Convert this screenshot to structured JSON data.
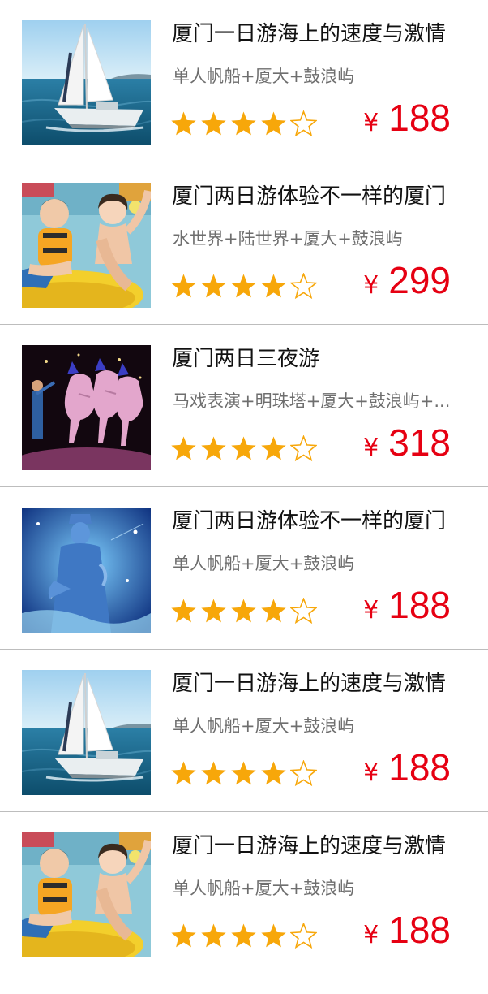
{
  "items": [
    {
      "title": "厦门一日游海上的速度与激情",
      "subtitle": "单人帆船+厦大+鼓浪屿",
      "rating": 4,
      "max_rating": 5,
      "currency": "¥",
      "price": "188",
      "image": "sailboat"
    },
    {
      "title": "厦门两日游体验不一样的厦门",
      "subtitle": "水世界+陆世界+厦大+鼓浪屿",
      "rating": 4,
      "max_rating": 5,
      "currency": "¥",
      "price": "299",
      "image": "water-park"
    },
    {
      "title": "厦门两日三夜游",
      "subtitle": "马戏表演+明珠塔+厦大+鼓浪屿+...",
      "rating": 4,
      "max_rating": 5,
      "currency": "¥",
      "price": "318",
      "image": "circus-horses"
    },
    {
      "title": "厦门两日游体验不一样的厦门",
      "subtitle": "单人帆船+厦大+鼓浪屿",
      "rating": 4,
      "max_rating": 5,
      "currency": "¥",
      "price": "188",
      "image": "statue"
    },
    {
      "title": "厦门一日游海上的速度与激情",
      "subtitle": "单人帆船+厦大+鼓浪屿",
      "rating": 4,
      "max_rating": 5,
      "currency": "¥",
      "price": "188",
      "image": "sailboat"
    },
    {
      "title": "厦门一日游海上的速度与激情",
      "subtitle": "单人帆船+厦大+鼓浪屿",
      "rating": 4,
      "max_rating": 5,
      "currency": "¥",
      "price": "188",
      "image": "water-park"
    }
  ],
  "colors": {
    "price": "#e60012",
    "star_filled": "#f7a70a",
    "star_empty_stroke": "#f7a70a",
    "divider": "#bdbdbd",
    "title": "#111111",
    "subtitle": "#6e6e6e"
  }
}
